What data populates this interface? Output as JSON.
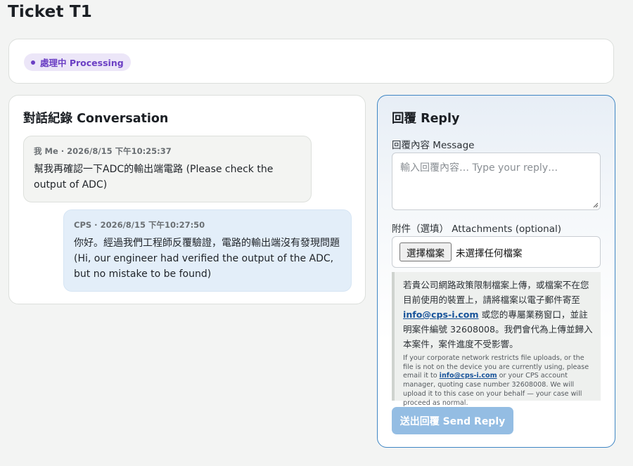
{
  "page": {
    "title": "Ticket T1"
  },
  "status": {
    "label": "處理中 Processing",
    "color": "#6b3fc4",
    "background": "#ece6f8"
  },
  "conversation": {
    "title": "對話紀錄 Conversation",
    "messages": [
      {
        "sender": "我 Me",
        "separator": "·",
        "timestamp": "2026/8/15 下午10:25:37",
        "text": "幫我再確認一下ADC的輸出端電路 (Please check the output of ADC)"
      },
      {
        "sender": "CPS",
        "separator": "·",
        "timestamp": "2026/8/15 下午10:27:50",
        "text": "你好。經過我們工程師反覆驗證，電路的輸出端沒有發現問題 (Hi, our engineer had verified the output of the ADC, but no mistake to be found)"
      }
    ]
  },
  "reply": {
    "title": "回覆 Reply",
    "message_label": "回覆內容 Message",
    "message_placeholder": "輸入回覆內容… Type your reply…",
    "message_value": "",
    "attachments_label": "附件（選填） Attachments (optional)",
    "file_button_label": "選擇檔案",
    "file_status": "未選擇任何檔案",
    "notice": {
      "zh_before": "若貴公司網路政策限制檔案上傳，或檔案不在您目前使用的裝置上，請將檔案以電子郵件寄至 ",
      "zh_email": "info@cps-i.com",
      "zh_after": " 或您的專屬業務窗口，並註明案件編號 32608008。我們會代為上傳並歸入本案件，案件進度不受影響。",
      "en_before": "If your corporate network restricts file uploads, or the file is not on the device you are currently using, please email it to ",
      "en_email": "info@cps-i.com",
      "en_after": " or your CPS account manager, quoting case number 32608008. We will upload it to this case on your behalf — your case will proceed as normal."
    },
    "send_label": "送出回覆 Send Reply",
    "accent_color": "#3f86c4",
    "send_color": "#94bde3"
  }
}
